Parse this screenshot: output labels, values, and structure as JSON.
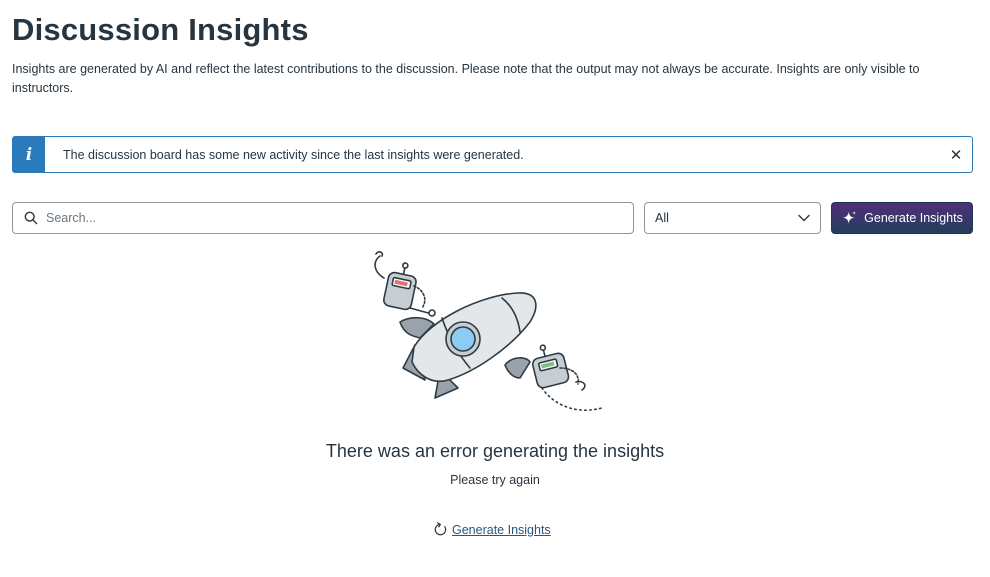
{
  "header": {
    "title": "Discussion Insights",
    "description": "Insights are generated by AI and reflect the latest contributions to the discussion. Please note that the output may not always be accurate. Insights are only visible to instructors."
  },
  "alert": {
    "icon": "info-icon",
    "icon_glyph": "i",
    "message": "The discussion board has some new activity since the last insights were generated.",
    "close_glyph": "✕",
    "accent_color": "#2B7ABC"
  },
  "toolbar": {
    "search": {
      "placeholder": "Search...",
      "value": ""
    },
    "filter": {
      "selected": "All"
    },
    "generate_button": {
      "label": "Generate Insights",
      "icon": "sparkle-icon"
    }
  },
  "empty_state": {
    "illustration": "rocket-robots-illustration",
    "title": "There was an error generating the insights",
    "subtitle": "Please try again",
    "retry_link": {
      "label": "Generate Insights",
      "icon": "refresh-icon"
    }
  },
  "colors": {
    "text": "#273540",
    "link": "#2B5580",
    "button_gradient_start": "#4F2F7A",
    "button_gradient_end": "#243E5C",
    "border": "#8D959F"
  }
}
